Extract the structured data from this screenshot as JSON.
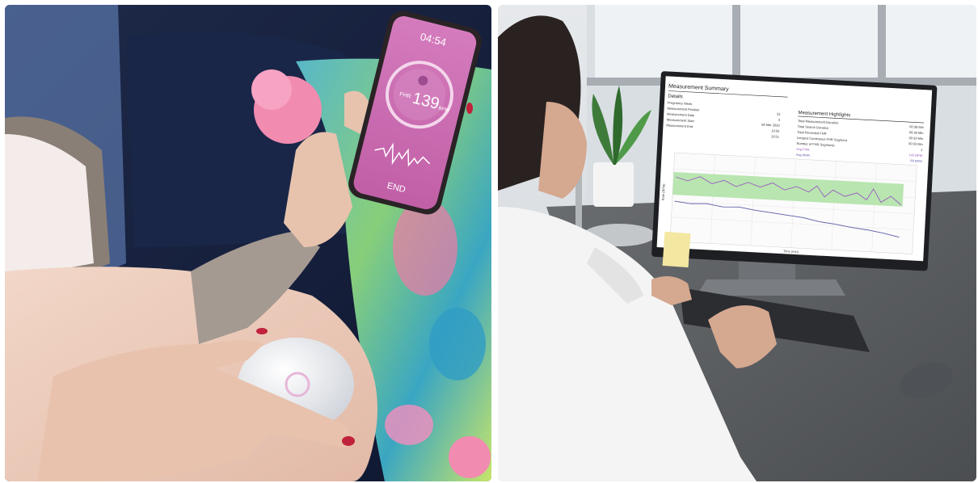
{
  "left_panel": {
    "phone": {
      "time": "04:54",
      "fhr_label": "FHR",
      "fhr_value": "139",
      "fhr_unit": "BPM",
      "end_button": "END"
    }
  },
  "right_panel": {
    "monitor": {
      "title": "Measurement Summary",
      "details_header": "Details",
      "details": [
        {
          "label": "Pregnancy Week",
          "value": ""
        },
        {
          "label": "Measurement Position",
          "value": "23"
        },
        {
          "label": "Measurement Date",
          "value": "3"
        },
        {
          "label": "Measurement Start",
          "value": "06 Mar 2020"
        },
        {
          "label": "Measurement End",
          "value": "10:50"
        },
        {
          "label": "",
          "value": "10:51"
        }
      ],
      "highlights_header": "Measurement Highlights",
      "highlights": [
        {
          "label": "Total Measurement Duration",
          "value": "00:38 Min"
        },
        {
          "label": "Total Search Duration",
          "value": "00:36 Min"
        },
        {
          "label": "Total Recorded FHR",
          "value": "00:33 Min"
        },
        {
          "label": "Longest Continuous FHR Segment",
          "value": "00:33 Min"
        },
        {
          "label": "Number of FHR Segments",
          "value": "1"
        },
        {
          "label": "Avg FHR",
          "value": "143 BPM"
        },
        {
          "label": "Avg MHR",
          "value": "89 BPM"
        }
      ],
      "chart_ylabel": "Rate (BPM)",
      "chart_xlabel": "Time (min)"
    }
  },
  "colors": {
    "phone_pink": "#d46fb0",
    "fhr_band": "#b9e5b0",
    "fhr_trace": "#9b5cc4",
    "mhr_trace": "#5c5ba8"
  }
}
